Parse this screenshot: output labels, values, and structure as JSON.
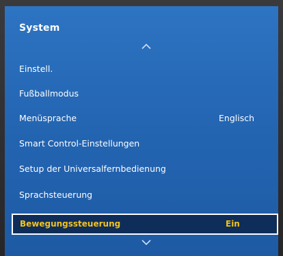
{
  "panel": {
    "title": "System",
    "items": [
      {
        "label": "Einstell.",
        "value": ""
      },
      {
        "label": "Fußballmodus",
        "value": ""
      },
      {
        "label": "Menüsprache",
        "value": "Englisch"
      },
      {
        "label": "Smart Control-Einstellungen",
        "value": ""
      },
      {
        "label": "Setup der Universalfernbedienung",
        "value": ""
      },
      {
        "label": "Sprachsteuerung",
        "value": ""
      },
      {
        "label": "Bewegungssteuerung",
        "value": "Ein"
      }
    ],
    "selected_index": 6
  },
  "colors": {
    "panel_blue": "#2466b3",
    "selected_bg": "#0f2d59",
    "selected_text": "#f2c31a",
    "text": "#ffffff"
  },
  "icons": {
    "scroll_up": "chevron-up-icon",
    "scroll_down": "chevron-down-icon"
  }
}
